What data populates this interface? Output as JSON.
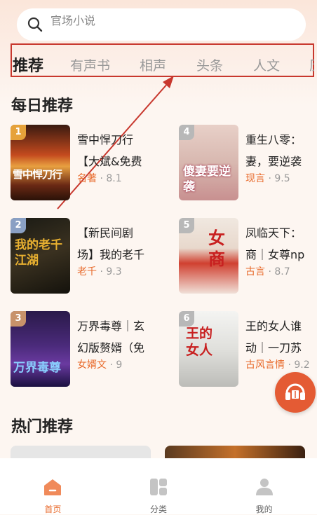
{
  "search": {
    "placeholder": "官场小说"
  },
  "tabs": [
    {
      "label": "推荐"
    },
    {
      "label": "有声书"
    },
    {
      "label": "相声"
    },
    {
      "label": "头条"
    },
    {
      "label": "人文"
    },
    {
      "label": "历"
    }
  ],
  "daily": {
    "title": "每日推荐",
    "books": [
      {
        "rank": "1",
        "title1": "雪中悍刀行",
        "title2": "【大斌&免费",
        "genre": "名著",
        "score": "8.1",
        "cover_text": "雪中悍刀行"
      },
      {
        "rank": "2",
        "title1": "【新民间剧",
        "title2": "场】我的老千",
        "genre": "老千",
        "score": "9.3",
        "cover_text": "我的老千江湖"
      },
      {
        "rank": "3",
        "title1": "万界毒尊｜玄",
        "title2": "幻版赘婿（免",
        "genre": "女婿文",
        "score": "9",
        "cover_text": "万界毒尊"
      },
      {
        "rank": "4",
        "title1": "重生八零：",
        "title2": "妻，要逆袭",
        "genre": "现言",
        "score": "9.5",
        "cover_text": "傻妻要逆袭"
      },
      {
        "rank": "5",
        "title1": "凤临天下：",
        "title2": "商｜女尊np",
        "genre": "古言",
        "score": "8.7",
        "cover_text": "女商"
      },
      {
        "rank": "6",
        "title1": "王的女人谁",
        "title2": "动｜一刀苏",
        "genre": "古风言情",
        "score": "9.2",
        "cover_text": "王的女人"
      }
    ]
  },
  "hot": {
    "title": "热门推荐"
  },
  "nav": [
    {
      "label": "首页",
      "icon": "home-icon"
    },
    {
      "label": "分类",
      "icon": "category-icon"
    },
    {
      "label": "我的",
      "icon": "profile-icon"
    }
  ],
  "colors": {
    "accent": "#e8692a",
    "highlight_box": "#c8382e",
    "audio_button": "#e45b34"
  }
}
